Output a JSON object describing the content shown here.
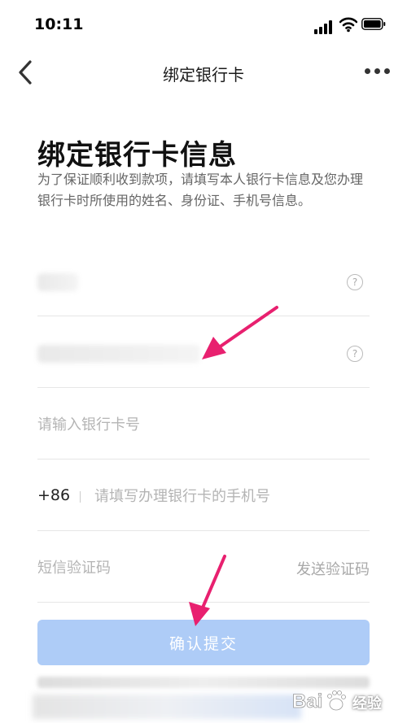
{
  "status_bar": {
    "time": "10:11"
  },
  "nav": {
    "title": "绑定银行卡"
  },
  "heading": {
    "title": "绑定银行卡信息",
    "description": "为了保证顺利收到款项，请填写本人银行卡信息及您办理银行卡时所使用的姓名、身份证、手机号信息。"
  },
  "form": {
    "card_number_placeholder": "请输入银行卡号",
    "country_code": "+86",
    "phone_placeholder": "请填写办理银行卡的手机号",
    "sms_code_placeholder": "短信验证码",
    "send_code_label": "发送验证码"
  },
  "submit": {
    "label": "确认提交"
  },
  "colors": {
    "accent_disabled": "#aeccf7",
    "arrow": "#e8206f"
  },
  "watermark": {
    "text": "Bai 经验"
  }
}
